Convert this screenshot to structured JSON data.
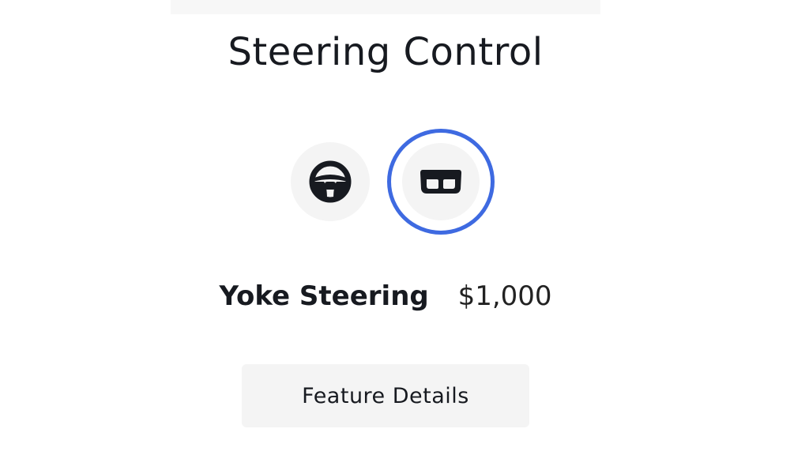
{
  "section": {
    "title": "Steering Control"
  },
  "options": [
    {
      "icon": "steering-wheel-icon",
      "selected": false
    },
    {
      "icon": "yoke-icon",
      "selected": true
    }
  ],
  "selected_option": {
    "name": "Yoke Steering",
    "price": "$1,000"
  },
  "details_button": {
    "label": "Feature Details"
  },
  "colors": {
    "selection_ring": "#3e6ae1",
    "option_background": "#f4f4f4",
    "text": "#171a20"
  }
}
